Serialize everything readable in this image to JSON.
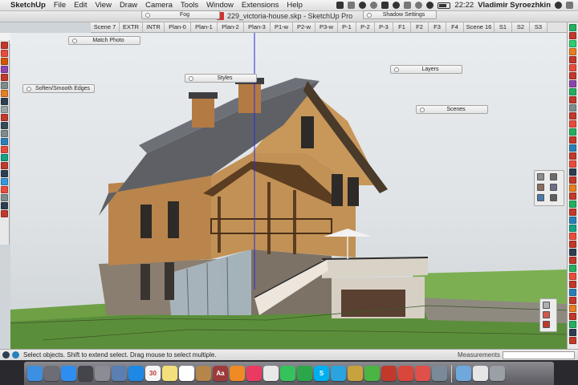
{
  "menubar": {
    "app_name": "SketchUp",
    "items": [
      "File",
      "Edit",
      "View",
      "Draw",
      "Camera",
      "Tools",
      "Window",
      "Extensions",
      "Help"
    ],
    "clock": "22:22",
    "user": "Vladimir Syroezhkin",
    "tray_icons": [
      "cloud-icon",
      "dropbox-icon",
      "skype-icon",
      "bluetooth-icon",
      "drive-icon",
      "wifi-icon",
      "volume-icon",
      "language-icon",
      "battery-icon",
      "timemachine-icon"
    ]
  },
  "window": {
    "title": "229_victoria-house.skp - SketchUp Pro"
  },
  "panels": {
    "fog": "Fog",
    "shadow_settings": "Shadow Settings",
    "match_photo": "Match Photo",
    "soften_edges": "Soften/Smooth Edges",
    "styles": "Styles",
    "layers": "Layers",
    "scenes": "Scenes"
  },
  "scene_tabs": [
    "Scene 7",
    "EXTR",
    "INTR",
    "Plan-0",
    "Plan-1",
    "Plan-2",
    "Plan-3",
    "P1-w",
    "P2-w",
    "P3-w",
    "P-1",
    "P-2",
    "P-3",
    "F1",
    "F2",
    "F3",
    "F4",
    "Scene 16",
    "S1",
    "S2",
    "S3"
  ],
  "statusbar": {
    "message": "Select objects. Shift to extend select. Drag mouse to select multiple.",
    "measurements_label": "Measurements",
    "measurements_value": ""
  },
  "left_toolbar_colors": [
    "#c0392b",
    "#e74c3c",
    "#d35400",
    "#8e44ad",
    "#c0392b",
    "#7f8c8d",
    "#e67e22",
    "#2c3e50",
    "#95a5a6",
    "#c0392b",
    "#34495e",
    "#7f8c8d",
    "#2980b9",
    "#e74c3c",
    "#16a085",
    "#c0392b",
    "#2c3e50",
    "#3498db",
    "#e74c3c",
    "#7f8c8d",
    "#2c3e50",
    "#c0392b"
  ],
  "right_toolbar_colors": [
    "#27ae60",
    "#c0392b",
    "#2ecc71",
    "#e67e22",
    "#c0392b",
    "#e74c3c",
    "#c0392b",
    "#8e44ad",
    "#27ae60",
    "#c0392b",
    "#7f8c8d",
    "#c0392b",
    "#e74c3c",
    "#27ae60",
    "#c0392b",
    "#2980b9",
    "#c0392b",
    "#e74c3c",
    "#2c3e50",
    "#c0392b",
    "#e67e22",
    "#c0392b",
    "#27ae60",
    "#c0392b",
    "#2980b9",
    "#16a085",
    "#e74c3c",
    "#c0392b",
    "#2c3e50",
    "#c0392b",
    "#27ae60",
    "#e74c3c",
    "#c0392b",
    "#2980b9",
    "#c0392b",
    "#e67e22",
    "#c0392b",
    "#27ae60",
    "#2c3e50",
    "#c0392b"
  ],
  "dock": {
    "apps": [
      {
        "name": "finder-icon",
        "color": "#3d8fe0",
        "label": ""
      },
      {
        "name": "launchpad-icon",
        "color": "#6d6d75",
        "label": ""
      },
      {
        "name": "app-store-icon",
        "color": "#2e8ef0",
        "label": ""
      },
      {
        "name": "mission-control-icon",
        "color": "#44444c",
        "label": ""
      },
      {
        "name": "system-preferences-icon",
        "color": "#8c8c94",
        "label": ""
      },
      {
        "name": "preview-icon",
        "color": "#5a7fb0",
        "label": ""
      },
      {
        "name": "safari-icon",
        "color": "#1e88e5",
        "label": ""
      },
      {
        "name": "calendar-icon",
        "color": "#f5f5f5",
        "label": "30"
      },
      {
        "name": "notes-icon",
        "color": "#f4e07a",
        "label": ""
      },
      {
        "name": "reminders-icon",
        "color": "#ffffff",
        "label": ""
      },
      {
        "name": "notebook-icon",
        "color": "#b5854a",
        "label": ""
      },
      {
        "name": "dictionary-icon",
        "color": "#9e3a3a",
        "label": "Aa"
      },
      {
        "name": "ibooks-icon",
        "color": "#f08a24",
        "label": ""
      },
      {
        "name": "itunes-icon",
        "color": "#ea3a62",
        "label": ""
      },
      {
        "name": "photos-icon",
        "color": "#e8e8e8",
        "label": ""
      },
      {
        "name": "messages-icon",
        "color": "#36c25a",
        "label": ""
      },
      {
        "name": "facetime-icon",
        "color": "#2ca64a",
        "label": ""
      },
      {
        "name": "skype-app-icon",
        "color": "#00aff0",
        "label": "S"
      },
      {
        "name": "telegram-icon",
        "color": "#2aa3de",
        "label": ""
      },
      {
        "name": "sketchup-app-icon",
        "color": "#c8a23c",
        "label": ""
      },
      {
        "name": "evernote-icon",
        "color": "#4bb543",
        "label": ""
      },
      {
        "name": "pencil-icon",
        "color": "#c0392b",
        "label": ""
      },
      {
        "name": "layout-icon",
        "color": "#d9463a",
        "label": ""
      },
      {
        "name": "style-builder-icon",
        "color": "#e0504a",
        "label": ""
      },
      {
        "name": "photo-viewer-icon",
        "color": "#7a8a9a",
        "label": ""
      },
      {
        "name": "folder-icon",
        "color": "#6fa8dc",
        "label": ""
      },
      {
        "name": "document-icon",
        "color": "#e6e6e6",
        "label": ""
      },
      {
        "name": "trash-icon",
        "color": "#9aa0a6",
        "label": ""
      }
    ]
  }
}
